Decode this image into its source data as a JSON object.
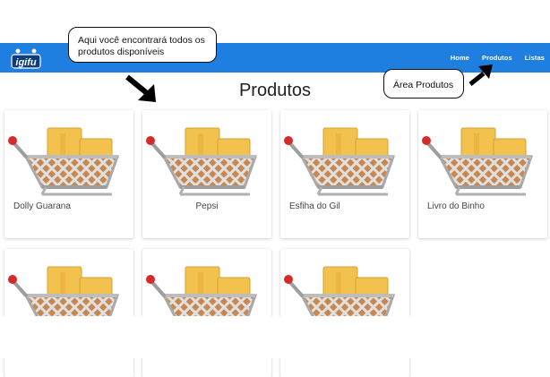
{
  "app": {
    "logo_text": "igifu"
  },
  "navbar": {
    "links": [
      {
        "label": "Home"
      },
      {
        "label": "Produtos"
      },
      {
        "label": "Listas"
      }
    ]
  },
  "page": {
    "title": "Produtos"
  },
  "products": [
    {
      "name": "Dolly Guarana",
      "image_icon": "shopping-cart-icon"
    },
    {
      "name": "Pepsi",
      "image_icon": "shopping-cart-icon"
    },
    {
      "name": "Esfiha do Gil",
      "image_icon": "shopping-cart-icon"
    },
    {
      "name": "Livro do Binho",
      "image_icon": "shopping-cart-icon"
    },
    {
      "name": "",
      "image_icon": "shopping-cart-icon"
    },
    {
      "name": "",
      "image_icon": "shopping-cart-icon"
    },
    {
      "name": "",
      "image_icon": "shopping-cart-icon"
    }
  ],
  "annotations": {
    "callout_products_list": "Aqui você encontrará todos os produtos disponíveis",
    "callout_products_area": "Área Produtos"
  },
  "colors": {
    "navbar": "#1f7fe0",
    "cart_red": "#d62a2a",
    "cart_box": "#f2c14e"
  }
}
